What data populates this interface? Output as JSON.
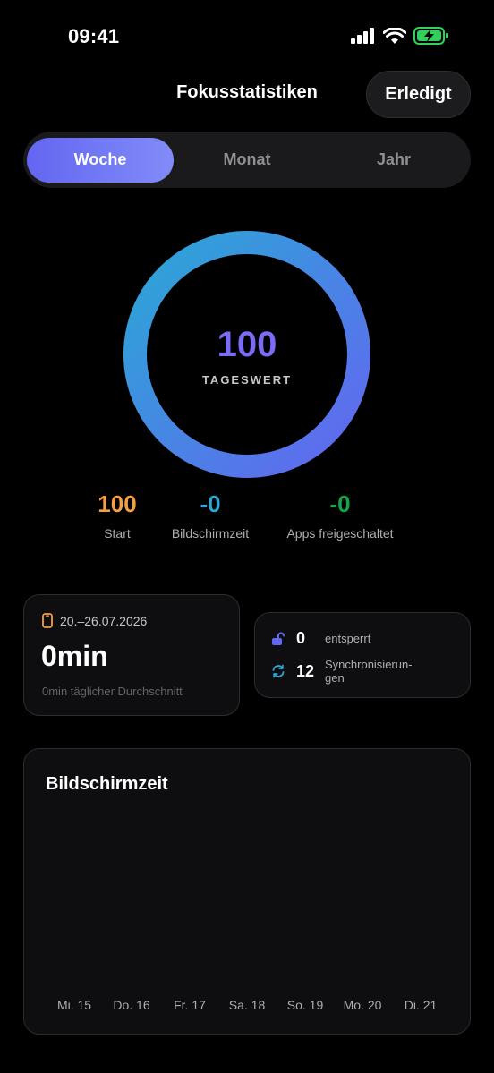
{
  "status": {
    "time": "09:41"
  },
  "header": {
    "title": "Fokusstatistiken",
    "done_label": "Erledigt"
  },
  "tabs": [
    {
      "label": "Woche",
      "active": true
    },
    {
      "label": "Monat",
      "active": false
    },
    {
      "label": "Jahr",
      "active": false
    }
  ],
  "score": {
    "value": "100",
    "label": "TAGESWERT",
    "progress": 1.0
  },
  "stats": [
    {
      "value": "100",
      "label": "Start",
      "color": "#f59e42"
    },
    {
      "value": "-0",
      "label": "Bildschirmzeit",
      "color": "#2aa7d6"
    },
    {
      "value": "-0",
      "label": "Apps freigeschaltet",
      "color": "#16a34a"
    }
  ],
  "week_card": {
    "range": "20.–26.07.2026",
    "total": "0min",
    "average": "0min täglicher Durchschnitt"
  },
  "unlock_card": {
    "unlocked_count": "0",
    "unlocked_label": "entsperrt",
    "sync_count": "12",
    "sync_label_line1": "Synchronisierun-",
    "sync_label_line2": "gen"
  },
  "screen_time_chart": {
    "title": "Bildschirmzeit",
    "days": [
      "Mi. 15",
      "Do. 16",
      "Fr. 17",
      "Sa. 18",
      "So. 19",
      "Mo. 20",
      "Di. 21"
    ]
  },
  "colors": {
    "accent": "#6366f1",
    "ring_start": "#6366f1",
    "ring_end": "#2aa7d6"
  }
}
